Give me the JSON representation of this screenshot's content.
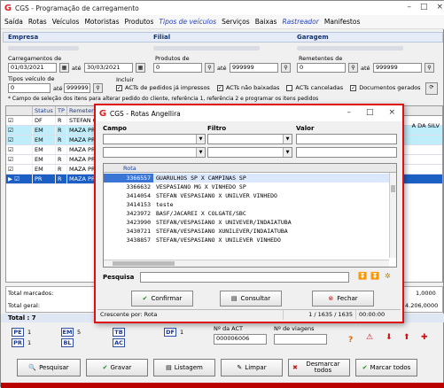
{
  "window": {
    "title": "CGS - Programação de carregamento",
    "logo": "G"
  },
  "menu": [
    {
      "label": "Saída",
      "style": "normal"
    },
    {
      "label": "Rotas",
      "style": "normal"
    },
    {
      "label": "Veículos",
      "style": "normal"
    },
    {
      "label": "Motoristas",
      "style": "normal"
    },
    {
      "label": "Produtos",
      "style": "normal"
    },
    {
      "label": "Tipos de veículos",
      "style": "blue"
    },
    {
      "label": "Serviços",
      "style": "normal"
    },
    {
      "label": "Baixas",
      "style": "normal"
    },
    {
      "label": "Rastreador",
      "style": "blue"
    },
    {
      "label": "Manifestos",
      "style": "normal"
    }
  ],
  "sections": {
    "empresa": "Empresa",
    "filial": "Filial",
    "garagem": "Garagem"
  },
  "filters": {
    "carregamentos_label": "Carregamentos de",
    "date_from": "01/03/2021",
    "ate": "até",
    "date_to": "30/03/2021",
    "produtos_label": "Produtos de",
    "produtos_from": "0",
    "produtos_to": "999999",
    "remetentes_label": "Remetentes de",
    "remetentes_from": "0",
    "remetentes_to": "999999",
    "tipo_veiculo_label": "Tipos veículo de",
    "tipo_from": "0",
    "tipo_to": "999999",
    "incluir_label": "Incluir",
    "checks": [
      {
        "label": "ACTs de pedidos já impressos",
        "checked": true
      },
      {
        "label": "ACTs não baixadas",
        "checked": true
      },
      {
        "label": "ACTs canceladas",
        "checked": false
      },
      {
        "label": "Documentos gerados",
        "checked": true
      }
    ],
    "hint": "* Campo de seleção dos itens para alterar pedido do cliente, referência 1, referência 2 e programar os itens pedidos"
  },
  "grid": {
    "headers": [
      "Status",
      "TP",
      "Remetente"
    ],
    "rows": [
      {
        "status": "DF",
        "tp": "R",
        "rem": "STEFAN O",
        "style": "white"
      },
      {
        "status": "EM",
        "tp": "R",
        "rem": "MAZA PROD",
        "style": "cyan"
      },
      {
        "status": "EM",
        "tp": "R",
        "rem": "MAZA PROD",
        "style": "cyan"
      },
      {
        "status": "EM",
        "tp": "R",
        "rem": "MAZA PROD",
        "style": "white"
      },
      {
        "status": "EM",
        "tp": "R",
        "rem": "MAZA PROD",
        "style": "white"
      },
      {
        "status": "EM",
        "tp": "R",
        "rem": "MAZA PROD",
        "style": "white"
      },
      {
        "status": "PR",
        "tp": "R",
        "rem": "MAZA PROD",
        "style": "sel"
      }
    ],
    "right_fragment": "A DA SILV"
  },
  "totals": {
    "marcados_label": "Total marcados:",
    "marcados_value": "1,0000",
    "geral_label": "Total geral:",
    "geral_value": "4.206,0000",
    "total_label": "Total : 7"
  },
  "status_counts": [
    {
      "code": "PE",
      "count": "1"
    },
    {
      "code": "EM",
      "count": "5"
    },
    {
      "code": "TB",
      "count": ""
    },
    {
      "code": "DF",
      "count": "1"
    },
    {
      "code": "PR",
      "count": "1"
    },
    {
      "code": "BL",
      "count": ""
    },
    {
      "code": "AC",
      "count": ""
    }
  ],
  "act": {
    "label": "Nº da ACT",
    "value": "000006006",
    "viagem_label": "Nº de viagens"
  },
  "buttons": {
    "pesquisar": "Pesquisar",
    "gravar": "Gravar",
    "listagem": "Listagem",
    "limpar": "Limpar",
    "desmarcar": "Desmarcar todos",
    "marcar": "Marcar todos"
  },
  "dialog": {
    "title": "CGS - Rotas Angellira",
    "campo_label": "Campo",
    "filtro_label": "Filtro",
    "valor_label": "Valor",
    "col_rota": "Rota",
    "rows": [
      {
        "code": "3366557",
        "name": "GUARULHOS SP X CAMPINAS SP",
        "selected": true
      },
      {
        "code": "3366632",
        "name": "VESPASIANO MG X VINHEDO SP",
        "selected": false
      },
      {
        "code": "3414054",
        "name": "STEFAN VESPASIANO X UNILVER VINHEDO",
        "selected": false
      },
      {
        "code": "3414153",
        "name": "teste",
        "selected": false
      },
      {
        "code": "3423972",
        "name": "BASF/JACAREI X COLGATE/SBC",
        "selected": false
      },
      {
        "code": "3423990",
        "name": "STEFAN/VESPASIANO X UNIVEVER/INDAIATUBA",
        "selected": false
      },
      {
        "code": "3430721",
        "name": "STEFAN/VESPASIANO XUNILEVER/INDAIATUBA",
        "selected": false
      },
      {
        "code": "3438857",
        "name": "STEFAN/VESPASIANO X UNILEVER VINHEDO",
        "selected": false
      }
    ],
    "pesquisa_label": "Pesquisa",
    "confirmar": "Confirmar",
    "consultar": "Consultar",
    "fechar": "Fechar",
    "status_sort": "Crescente por: Rota",
    "status_count": "1 / 1635 / 1635",
    "status_time": "00:00:00"
  },
  "colors": {
    "dialog_border": "#dd1111",
    "accent": "#1b5fc5",
    "logo": "#dd2222"
  }
}
